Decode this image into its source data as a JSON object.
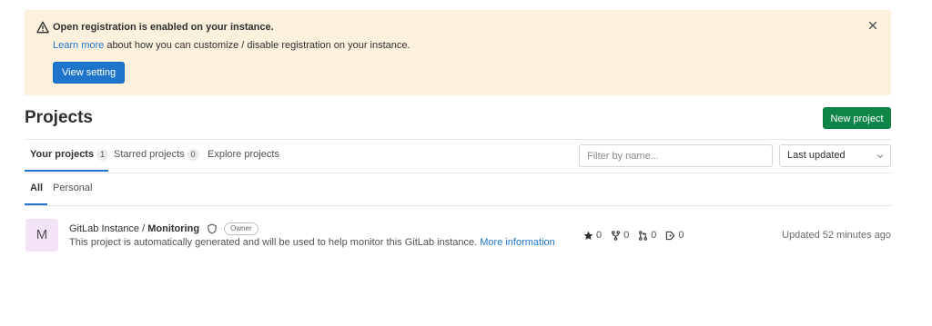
{
  "alert": {
    "title": "Open registration is enabled on your instance.",
    "learn_more": "Learn more",
    "body_rest": " about how you can customize / disable registration on your instance.",
    "button": "View setting"
  },
  "page": {
    "title": "Projects",
    "new_project": "New project"
  },
  "tabs": [
    {
      "label": "Your projects",
      "count": "1"
    },
    {
      "label": "Starred projects",
      "count": "0"
    },
    {
      "label": "Explore projects"
    }
  ],
  "filter": {
    "placeholder": "Filter by name...",
    "sort": "Last updated"
  },
  "subtabs": [
    "All",
    "Personal"
  ],
  "project": {
    "avatar": "M",
    "namespace": "GitLab Instance / ",
    "name": "Monitoring",
    "role": "Owner",
    "description": "This project is automatically generated and will be used to help monitor this GitLab instance. ",
    "more_info": "More information",
    "stars": "0",
    "forks": "0",
    "merge_requests": "0",
    "issues": "0",
    "updated": "Updated 52 minutes ago"
  },
  "colors": {
    "alert_bg": "#fdf1dd",
    "primary": "#1f75cb",
    "success": "#108548"
  },
  "icons": [
    "warning-icon",
    "close-icon",
    "shield-icon",
    "star-icon",
    "fork-icon",
    "merge-request-icon",
    "issues-icon",
    "chevron-down-icon"
  ]
}
